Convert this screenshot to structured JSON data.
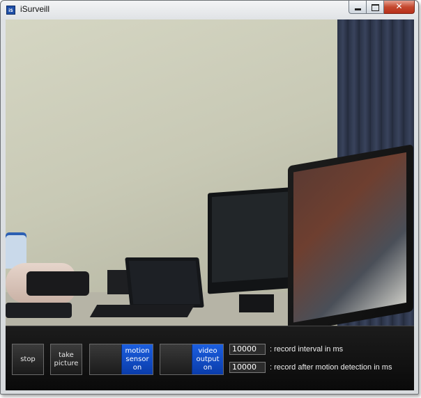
{
  "window": {
    "title": "iSurveill",
    "icon_text": "iS",
    "controls": [
      "minimize",
      "maximize",
      "close"
    ],
    "close_glyph": "✕"
  },
  "camera_feed": {
    "description_icon": "webcam-video-feed"
  },
  "controls": {
    "stop_label": "stop",
    "take_picture_label": "take picture",
    "motion_sensor_label": "motion sensor on",
    "video_output_label": "video output on",
    "record_interval": {
      "value": "10000",
      "label": ": record interval in ms"
    },
    "record_after_motion": {
      "value": "10000",
      "label": ": record after motion detection in ms"
    }
  },
  "colors": {
    "toggle_on": "#1c5fe0",
    "panel_bg": "#0a0a0a",
    "close_button": "#c4482e"
  }
}
